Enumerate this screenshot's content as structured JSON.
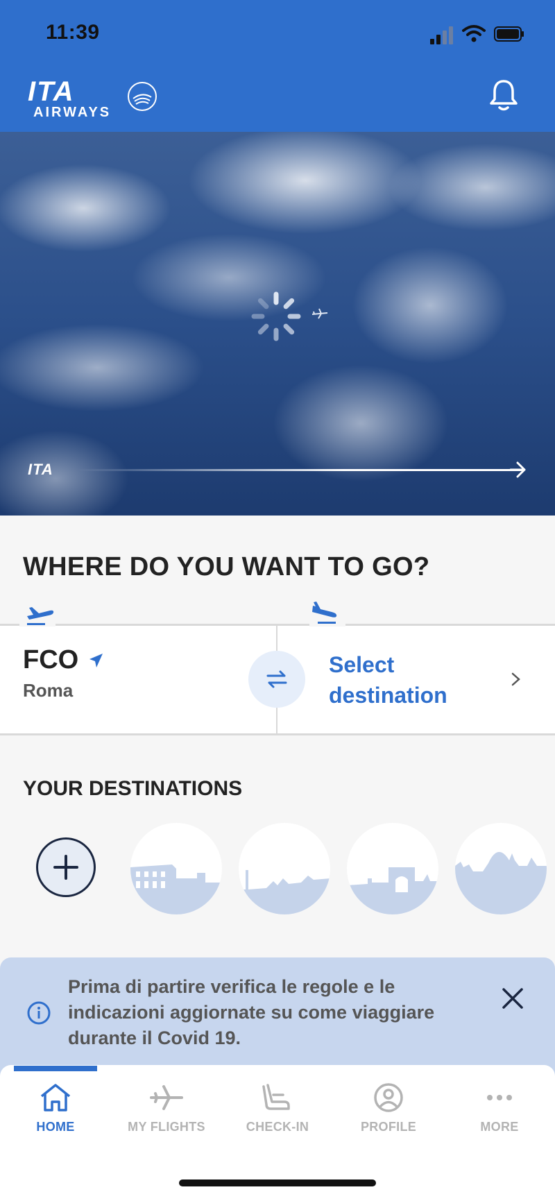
{
  "status_bar": {
    "time": "11:39"
  },
  "header": {
    "logo_text": "ITA",
    "logo_subtext": "AIRWAYS",
    "alliance_logo_text": "SKYTEAM"
  },
  "hero": {
    "logo_text": "ITA"
  },
  "search": {
    "title": "WHERE DO YOU WANT TO GO?",
    "origin_code": "FCO",
    "origin_city": "Roma",
    "destination_placeholder": "Select destination"
  },
  "destinations": {
    "title": "YOUR DESTINATIONS",
    "items": [
      "colosseum-skyline",
      "city-skyline",
      "arch-skyline",
      "dome-skyline"
    ]
  },
  "banner": {
    "text": "Prima di partire verifica le regole e le indicazioni aggiornate su come viaggiare durante il Covid 19."
  },
  "tabs": [
    {
      "label": "HOME",
      "icon": "home-icon",
      "active": true
    },
    {
      "label": "MY FLIGHTS",
      "icon": "airplane-icon",
      "active": false
    },
    {
      "label": "CHECK-IN",
      "icon": "seat-icon",
      "active": false
    },
    {
      "label": "PROFILE",
      "icon": "user-circle-icon",
      "active": false
    },
    {
      "label": "MORE",
      "icon": "more-dots-icon",
      "active": false
    }
  ],
  "colors": {
    "brand": "#2f6fcc",
    "dark": "#1a2640",
    "banner": "#c7d6ee",
    "skyline": "#c5d3ea"
  }
}
